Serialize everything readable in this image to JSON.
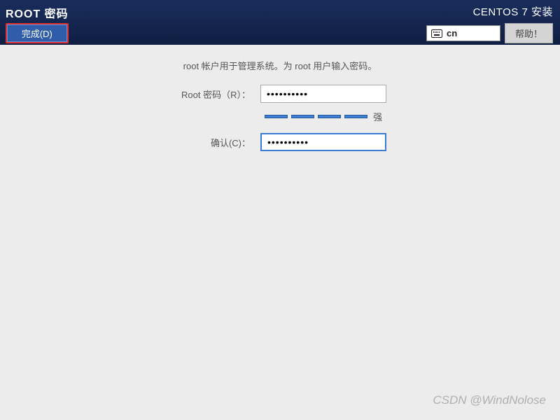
{
  "header": {
    "page_title": "ROOT 密码",
    "done_label": "完成(D)",
    "installer_title": "CENTOS 7 安装",
    "lang_code": "cn",
    "help_label": "帮助！"
  },
  "form": {
    "instruction": "root 帐户用于管理系统。为 root 用户输入密码。",
    "password_label": "Root 密码（R）：",
    "password_value": "••••••••••",
    "confirm_label": "确认(C)：",
    "confirm_value": "••••••••••",
    "strength_label": "强"
  },
  "watermark": "CSDN @WindNolose"
}
